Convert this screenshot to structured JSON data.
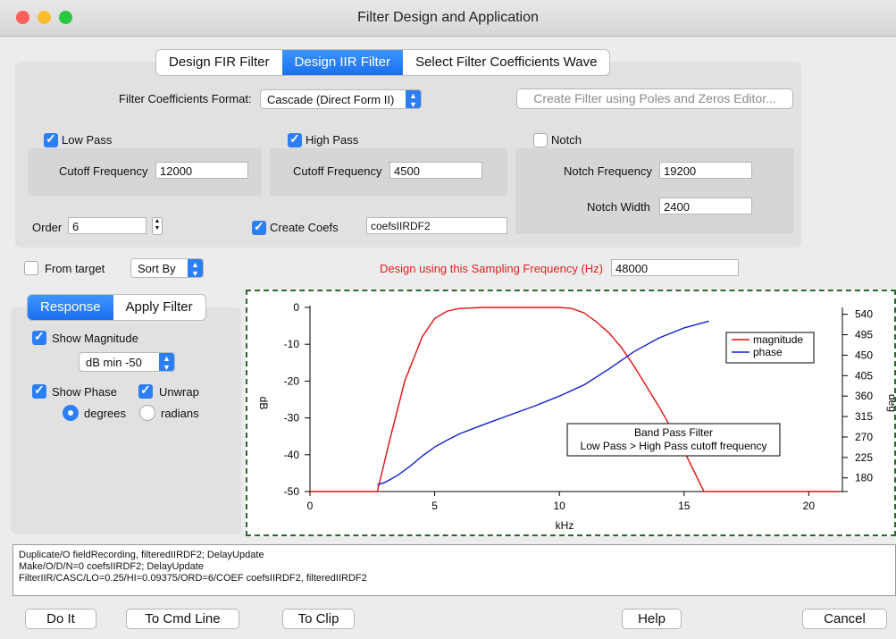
{
  "window": {
    "title": "Filter Design and Application"
  },
  "tabs": [
    "Design FIR Filter",
    "Design IIR Filter",
    "Select Filter Coefficients Wave"
  ],
  "coef_format": {
    "label": "Filter Coefficients Format:",
    "value": "Cascade (Direct Form II)"
  },
  "poles_button": "Create Filter using Poles and Zeros Editor...",
  "lowpass": {
    "label": "Low Pass",
    "checked": true,
    "cutoff_label": "Cutoff Frequency",
    "cutoff": "12000"
  },
  "highpass": {
    "label": "High Pass",
    "checked": true,
    "cutoff_label": "Cutoff Frequency",
    "cutoff": "4500"
  },
  "notch": {
    "label": "Notch",
    "checked": false,
    "freq_label": "Notch Frequency",
    "freq": "19200",
    "width_label": "Notch Width",
    "width": "2400"
  },
  "order": {
    "label": "Order",
    "value": "6"
  },
  "create_coefs": {
    "label": "Create Coefs",
    "checked": true,
    "name": "coefsIIRDF2"
  },
  "from_target": {
    "label": "From target",
    "checked": false
  },
  "sort_by": "Sort By",
  "sampling": {
    "label": "Design using this Sampling Frequency (Hz)",
    "value": "48000",
    "color": "#e02020"
  },
  "subtabs": [
    "Response",
    "Apply Filter"
  ],
  "options": {
    "show_magnitude": "Show Magnitude",
    "db_min": "dB min -50",
    "show_phase": "Show Phase",
    "unwrap": "Unwrap",
    "degrees": "degrees",
    "radians": "radians"
  },
  "command_lines": [
    "Duplicate/O fieldRecording, filteredIIRDF2; DelayUpdate",
    "Make/O/D/N=0 coefsIIRDF2; DelayUpdate",
    "FilterIIR/CASC/LO=0.25/HI=0.09375/ORD=6/COEF coefsIIRDF2, filteredIIRDF2"
  ],
  "buttons": {
    "do_it": "Do It",
    "to_cmd": "To Cmd Line",
    "to_clip": "To Clip",
    "help": "Help",
    "cancel": "Cancel"
  },
  "chart_data": {
    "type": "line",
    "xlabel": "kHz",
    "ylabel": "dB",
    "y2label": "deg",
    "xlim": [
      0,
      24
    ],
    "ylim": [
      -50,
      0
    ],
    "y2lim": [
      150,
      555
    ],
    "xticks": [
      0,
      5,
      10,
      15,
      20
    ],
    "yticks": [
      0,
      -10,
      -20,
      -30,
      -40,
      -50
    ],
    "y2ticks": [
      540,
      495,
      450,
      405,
      360,
      315,
      270,
      225,
      180
    ],
    "annotation": [
      "Band Pass Filter",
      "Low Pass > High Pass cutoff frequency"
    ],
    "legend_position": "top-right",
    "series": [
      {
        "name": "magnitude",
        "color": "#e01010",
        "axis": "left",
        "x": [
          0,
          2.7,
          3.2,
          3.8,
          4.5,
          5.0,
          5.5,
          6.0,
          7,
          8,
          9,
          10,
          10.5,
          11,
          11.5,
          12,
          12.5,
          13,
          14,
          15,
          15.8,
          16,
          20,
          24
        ],
        "y": [
          -50,
          -50,
          -36,
          -20,
          -8,
          -3,
          -1,
          -0.3,
          0,
          0,
          0,
          0,
          -0.3,
          -1.5,
          -4,
          -7,
          -11,
          -16,
          -27,
          -39,
          -50,
          -50,
          -50,
          -50
        ]
      },
      {
        "name": "phase",
        "color": "#1020d0",
        "axis": "right",
        "x": [
          2.7,
          3.0,
          3.5,
          4.0,
          4.5,
          5.0,
          5.5,
          6.0,
          7,
          8,
          9,
          10,
          11,
          12,
          13,
          14,
          15,
          16
        ],
        "y": [
          165,
          170,
          185,
          205,
          228,
          248,
          263,
          277,
          298,
          318,
          338,
          360,
          385,
          420,
          458,
          488,
          510,
          525
        ]
      }
    ]
  }
}
